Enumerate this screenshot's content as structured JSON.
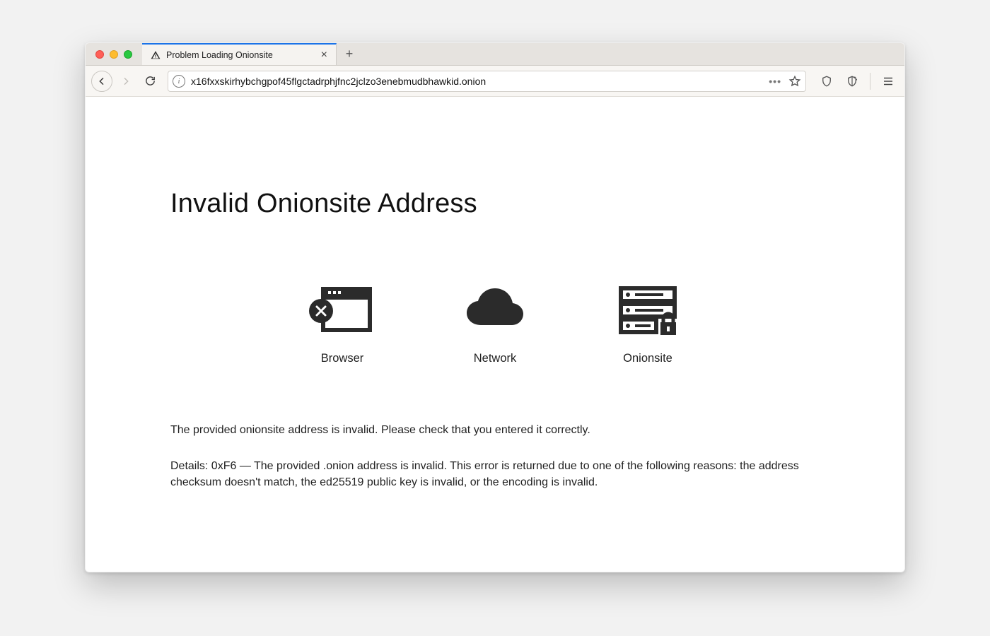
{
  "tab": {
    "title": "Problem Loading Onionsite"
  },
  "urlbar": {
    "value": "x16fxxskirhybchgpof45flgctadrphjfnc2jclzo3enebmudbhawkid.onion"
  },
  "page": {
    "heading": "Invalid Onionsite Address",
    "diagram": {
      "browser_label": "Browser",
      "network_label": "Network",
      "onionsite_label": "Onionsite"
    },
    "message": "The provided onionsite address is invalid. Please check that you entered it correctly.",
    "details": "Details: 0xF6 — The provided .onion address is invalid. This error is returned due to one of the following reasons: the address checksum doesn't match, the ed25519 public key is invalid, or the encoding is invalid."
  }
}
